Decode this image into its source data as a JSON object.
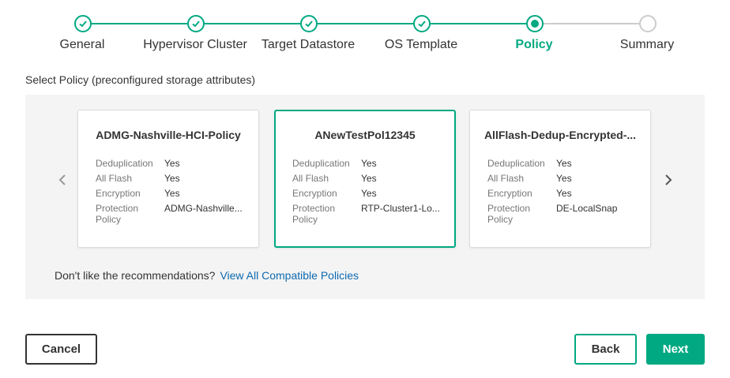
{
  "colors": {
    "accent": "#01a982",
    "link": "#0d69b0",
    "pending": "#cccccc",
    "panel_bg": "#f4f4f4"
  },
  "stepper": {
    "steps": [
      {
        "label": "General",
        "state": "completed",
        "icon": "check-icon"
      },
      {
        "label": "Hypervisor Cluster",
        "state": "completed",
        "icon": "check-icon"
      },
      {
        "label": "Target Datastore",
        "state": "completed",
        "icon": "check-icon"
      },
      {
        "label": "OS Template",
        "state": "completed",
        "icon": "check-icon"
      },
      {
        "label": "Policy",
        "state": "active",
        "icon": "dot-icon"
      },
      {
        "label": "Summary",
        "state": "pending",
        "icon": "empty-circle-icon"
      }
    ]
  },
  "section_title": "Select Policy (preconfigured storage attributes)",
  "carousel": {
    "prev_icon": "chevron-left-icon",
    "next_icon": "chevron-right-icon",
    "cards": [
      {
        "title": "ADMG-Nashville-HCI-Policy",
        "selected": false,
        "attributes": [
          {
            "key": "Deduplication",
            "value": "Yes"
          },
          {
            "key": "All Flash",
            "value": "Yes"
          },
          {
            "key": "Encryption",
            "value": "Yes"
          },
          {
            "key": "Protection Policy",
            "value": "ADMG-Nashville..."
          }
        ]
      },
      {
        "title": "ANewTestPol12345",
        "selected": true,
        "attributes": [
          {
            "key": "Deduplication",
            "value": "Yes"
          },
          {
            "key": "All Flash",
            "value": "Yes"
          },
          {
            "key": "Encryption",
            "value": "Yes"
          },
          {
            "key": "Protection Policy",
            "value": "RTP-Cluster1-Lo..."
          }
        ]
      },
      {
        "title": "AllFlash-Dedup-Encrypted-...",
        "selected": false,
        "attributes": [
          {
            "key": "Deduplication",
            "value": "Yes"
          },
          {
            "key": "All Flash",
            "value": "Yes"
          },
          {
            "key": "Encryption",
            "value": "Yes"
          },
          {
            "key": "Protection Policy",
            "value": "DE-LocalSnap"
          }
        ]
      }
    ]
  },
  "recommendation": {
    "text": "Don't like the recommendations?",
    "link": "View All Compatible Policies"
  },
  "footer": {
    "cancel_label": "Cancel",
    "back_label": "Back",
    "next_label": "Next"
  }
}
